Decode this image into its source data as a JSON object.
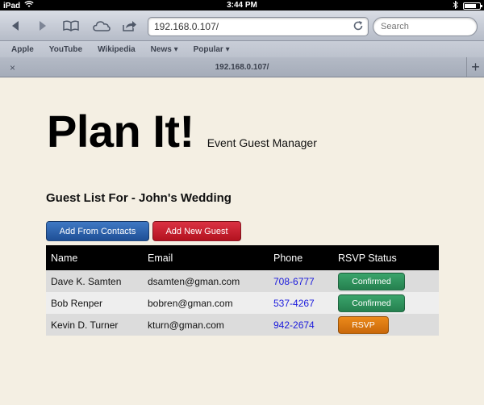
{
  "statusbar": {
    "device": "iPad",
    "time": "3:44 PM"
  },
  "toolbar": {
    "url": "192.168.0.107/",
    "search_placeholder": "Search"
  },
  "bookmarks": [
    "Apple",
    "YouTube",
    "Wikipedia",
    "News ▾",
    "Popular ▾"
  ],
  "tab": {
    "title": "192.168.0.107/",
    "close": "×",
    "new": "+"
  },
  "page": {
    "brand": "Plan It!",
    "subtitle": "Event Guest Manager",
    "guest_list_title": "Guest List For - John's Wedding",
    "buttons": {
      "add_from_contacts": "Add From Contacts",
      "add_new_guest": "Add New Guest"
    },
    "table": {
      "headers": [
        "Name",
        "Email",
        "Phone",
        "RSVP Status"
      ],
      "rows": [
        {
          "name": "Dave K. Samten",
          "email": "dsamten@gman.com",
          "phone": "708-6777",
          "status": "Confirmed",
          "status_color": "#2e915c"
        },
        {
          "name": "Bob Renper",
          "email": "bobren@gman.com",
          "phone": "537-4267",
          "status": "Confirmed",
          "status_color": "#2e915c"
        },
        {
          "name": "Kevin D. Turner",
          "email": "kturn@gman.com",
          "phone": "942-2674",
          "status": "RSVP",
          "status_color": "#dd7a12"
        }
      ]
    }
  },
  "colors": {
    "page_bg": "#f4efe3",
    "primary": "#2c63ad",
    "danger": "#c41f2c",
    "link": "#1a1adc"
  },
  "battery_level": 0.8
}
